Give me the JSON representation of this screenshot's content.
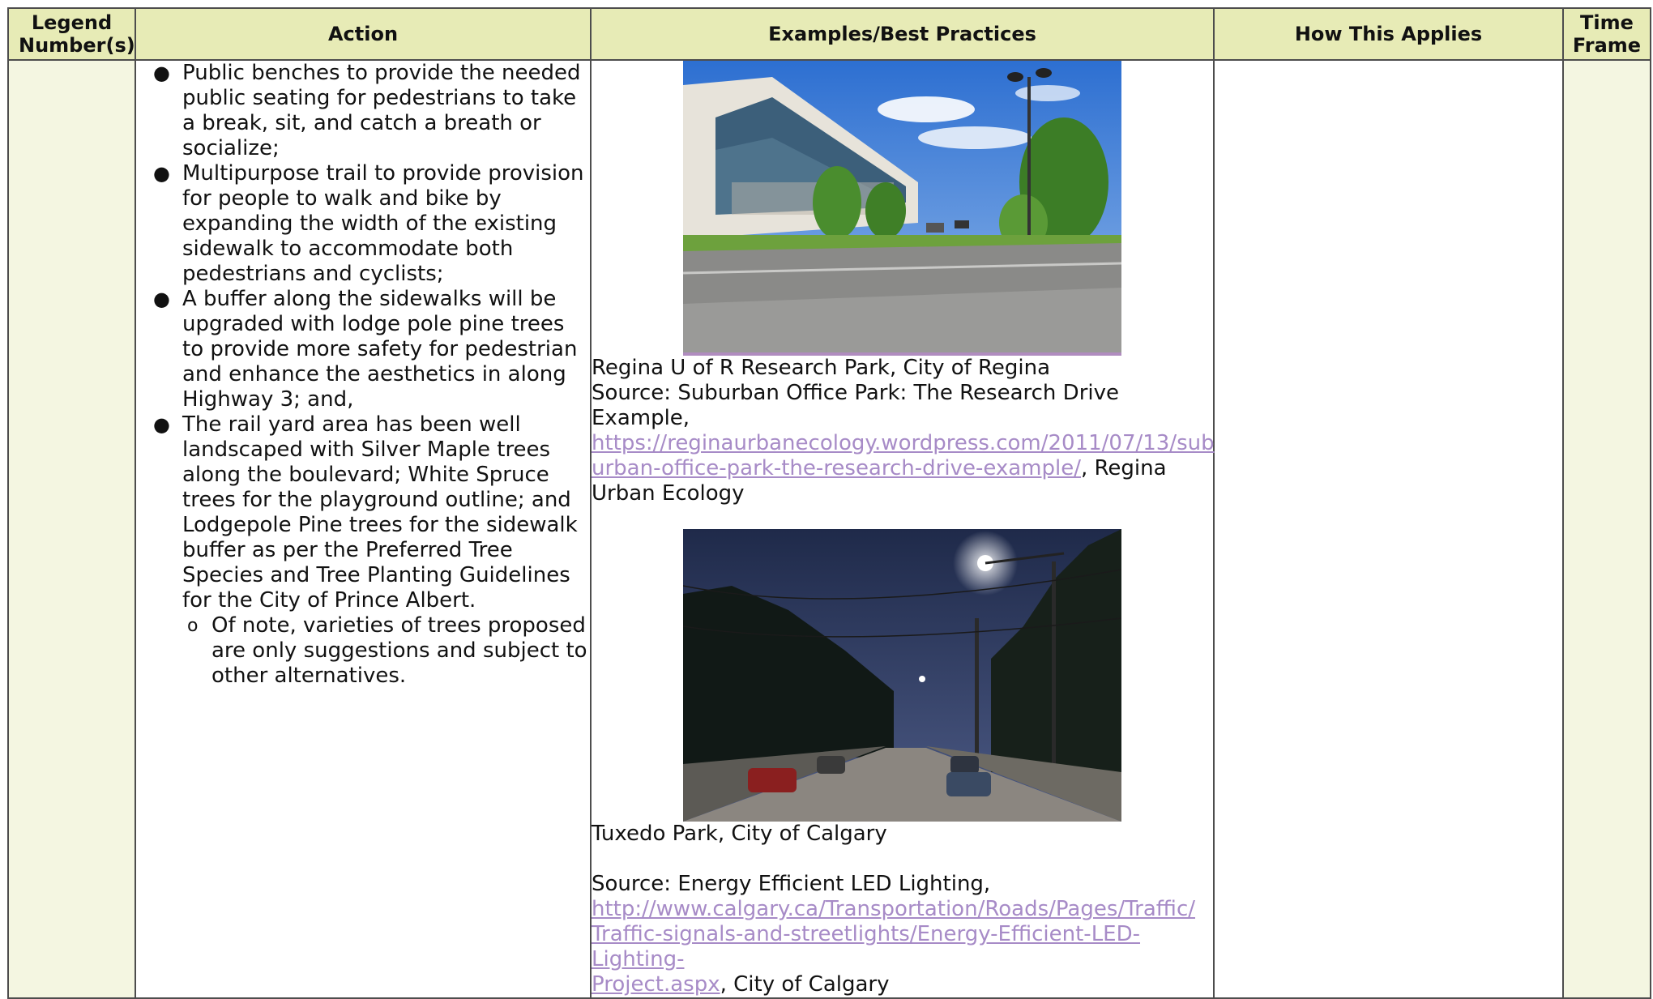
{
  "headers": {
    "legend": "Legend Number(s)",
    "action": "Action",
    "examples": "Examples/Best Practices",
    "applies": "How This Applies",
    "time": "Time Frame"
  },
  "action_items": [
    "Public benches to provide the needed public seating for pedestrians to take a break, sit, and catch a breath or socialize;",
    "Multipurpose trail to provide provision for people to walk and bike by expanding the width of the existing sidewalk to accommodate both pedestrians and cyclists;",
    "A buffer along the sidewalks will be upgraded with lodge pole pine trees to provide more safety for pedestrian and enhance the aesthetics in along Highway 3; and,",
    "The rail yard area has been well landscaped with Silver Maple trees along the boulevard; White Spruce trees for the playground outline; and Lodgepole Pine trees for the sidewalk buffer as per the Preferred Tree Species and Tree Planting Guidelines for the City of Prince Albert."
  ],
  "action_subitem": "Of note, varieties of trees proposed are only suggestions and subject to other alternatives.",
  "examples": {
    "ex1": {
      "title": "Regina U of R Research Park, City of Regina",
      "source": "Source: Suburban Office Park: The Research Drive Example,",
      "link": "https://reginaurbanecology.wordpress.com/2011/07/13/suburban-office-park-the-research-drive-example/",
      "link_line1": "https://reginaurbanecology.wordpress.com/2011/07/13/sub",
      "link_line2": "urban-office-park-the-research-drive-example/",
      "after_link": ", Regina",
      "tail": "Urban Ecology"
    },
    "ex2": {
      "title": "Tuxedo Park, City of Calgary",
      "source": "Source: Energy Efficient LED Lighting,",
      "link_line1": "http://www.calgary.ca/Transportation/Roads/Pages/Traffic/",
      "link_line2": "Traffic-signals-and-streetlights/Energy-Efficient-LED-Lighting-",
      "link_line3": "Project.aspx",
      "after_link": ", City of Calgary"
    }
  },
  "colors": {
    "header_bg": "#e7ebb6",
    "side_col_bg": "#f4f6e1",
    "link": "#a78bc7",
    "border": "#4d4d4d"
  }
}
